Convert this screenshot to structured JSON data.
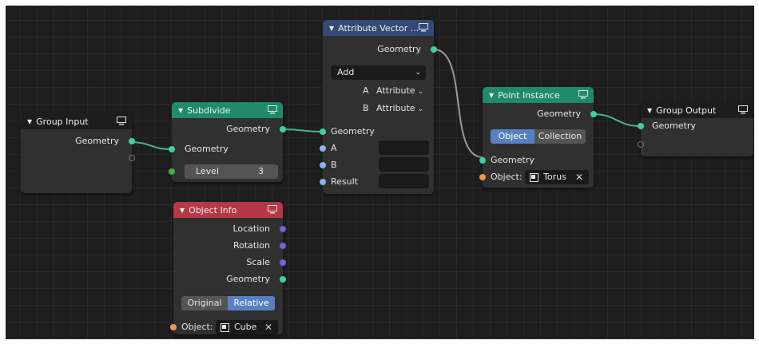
{
  "nodes": {
    "group_input": {
      "title": "Group Input",
      "out_geometry": "Geometry"
    },
    "subdivide": {
      "title": "Subdivide",
      "out_geometry": "Geometry",
      "in_geometry": "Geometry",
      "level_label": "Level",
      "level_value": "3"
    },
    "attribute_vector": {
      "title": "Attribute Vector ...",
      "out_geometry": "Geometry",
      "operation": "Add",
      "a_label": "A",
      "a_value": "Attribute",
      "b_label": "B",
      "b_value": "Attribute",
      "in_geometry": "Geometry",
      "in_a": "A",
      "in_b": "B",
      "in_result": "Result"
    },
    "point_instance": {
      "title": "Point Instance",
      "out_geometry": "Geometry",
      "mode_object": "Object",
      "mode_collection": "Collection",
      "mode_selected": "Object",
      "in_geometry": "Geometry",
      "object_label": "Object:",
      "object_value": "Torus"
    },
    "group_output": {
      "title": "Group Output",
      "in_geometry": "Geometry"
    },
    "object_info": {
      "title": "Object Info",
      "out_location": "Location",
      "out_rotation": "Rotation",
      "out_scale": "Scale",
      "out_geometry": "Geometry",
      "mode_original": "Original",
      "mode_relative": "Relative",
      "mode_selected": "Relative",
      "object_label": "Object:",
      "object_value": "Cube"
    }
  },
  "colors": {
    "canvas": "#1e1e1e",
    "node_body": "#303030",
    "header_input_output": "#1d1d1d",
    "header_geometry": "#1f8a6c",
    "header_attribute": "#334a76",
    "header_input_red": "#b53846",
    "socket_geometry": "#3fd0a0",
    "socket_vector": "#6e63d8",
    "socket_float": "#8fb0e8",
    "socket_object": "#ee9a45",
    "socket_integer": "#3bb34a",
    "toggle_active": "#5680c2"
  },
  "icons": {
    "header_icon": "monitor-icon",
    "collapse_icon": "triangle-down-icon",
    "object_icon": "object-icon",
    "clear_icon": "close-icon",
    "dropdown_icon": "chevron-down-icon"
  }
}
